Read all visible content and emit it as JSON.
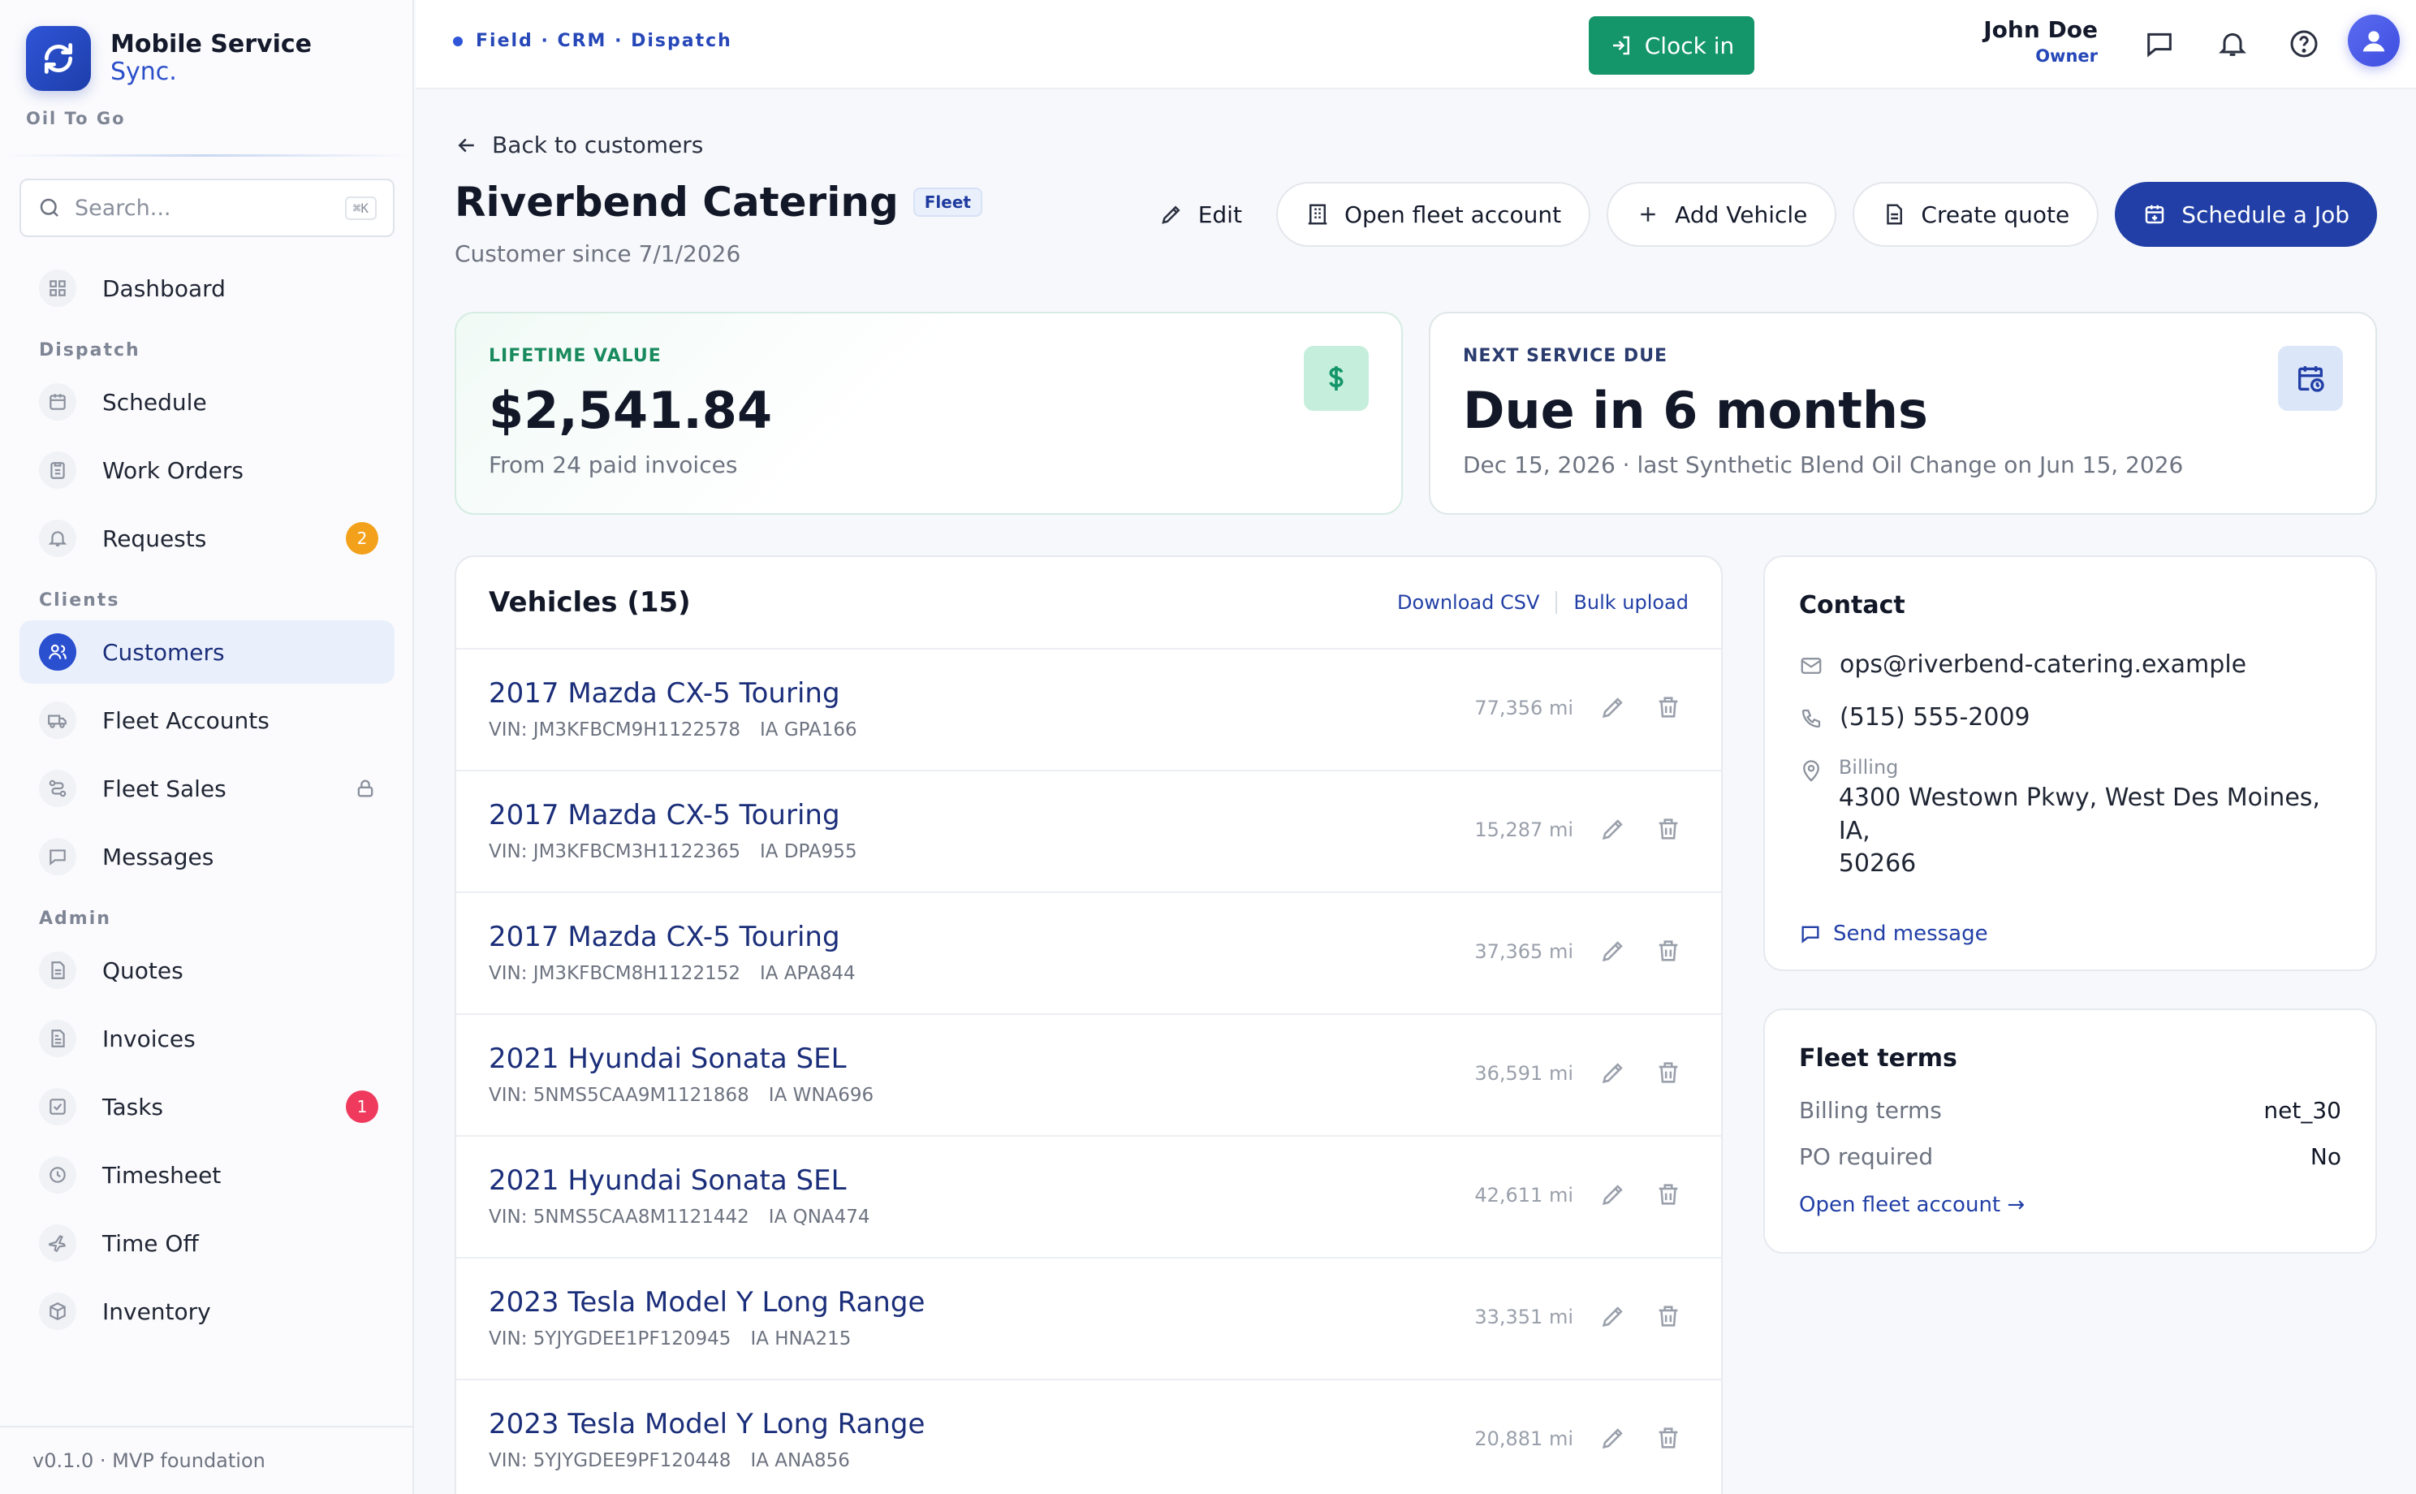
{
  "brand": {
    "name": "Mobile Service",
    "sub": "Sync.",
    "org": "Oil To Go"
  },
  "search": {
    "placeholder": "Search...",
    "shortcut": "⌘K"
  },
  "nav": {
    "dashboard": "Dashboard",
    "dispatch_section": "Dispatch",
    "schedule": "Schedule",
    "work_orders": "Work Orders",
    "requests": "Requests",
    "requests_badge": "2",
    "clients_section": "Clients",
    "customers": "Customers",
    "fleet_accounts": "Fleet Accounts",
    "fleet_sales": "Fleet Sales",
    "messages": "Messages",
    "admin_section": "Admin",
    "quotes": "Quotes",
    "invoices": "Invoices",
    "tasks": "Tasks",
    "tasks_badge": "1",
    "timesheet": "Timesheet",
    "time_off": "Time Off",
    "inventory": "Inventory"
  },
  "footer": {
    "version": "v0.1.0 · MVP foundation"
  },
  "topbar": {
    "crumbs": "Field · CRM · Dispatch",
    "clock_in": "Clock in",
    "user_name": "John Doe",
    "user_role": "Owner"
  },
  "page": {
    "back": "Back to customers",
    "title": "Riverbend Catering",
    "badge": "Fleet",
    "since": "Customer since 7/1/2026",
    "actions": {
      "edit": "Edit",
      "open_fleet": "Open fleet account",
      "add_vehicle": "Add Vehicle",
      "create_quote": "Create quote",
      "schedule_job": "Schedule a Job"
    }
  },
  "stats": {
    "lifetime_label": "LIFETIME VALUE",
    "lifetime_value": "$2,541.84",
    "lifetime_sub": "From 24 paid invoices",
    "next_label": "NEXT SERVICE DUE",
    "next_value": "Due in 6 months",
    "next_sub": "Dec 15, 2026 · last Synthetic Blend Oil Change on Jun 15, 2026"
  },
  "vehicles": {
    "title": "Vehicles (15)",
    "download": "Download CSV",
    "bulk": "Bulk upload",
    "rows": [
      {
        "name": "2017 Mazda CX-5 Touring",
        "vin": "VIN: JM3KFBCM9H1122578",
        "plate": "IA GPA166",
        "miles": "77,356 mi"
      },
      {
        "name": "2017 Mazda CX-5 Touring",
        "vin": "VIN: JM3KFBCM3H1122365",
        "plate": "IA DPA955",
        "miles": "15,287 mi"
      },
      {
        "name": "2017 Mazda CX-5 Touring",
        "vin": "VIN: JM3KFBCM8H1122152",
        "plate": "IA APA844",
        "miles": "37,365 mi"
      },
      {
        "name": "2021 Hyundai Sonata SEL",
        "vin": "VIN: 5NMS5CAA9M1121868",
        "plate": "IA WNA696",
        "miles": "36,591 mi"
      },
      {
        "name": "2021 Hyundai Sonata SEL",
        "vin": "VIN: 5NMS5CAA8M1121442",
        "plate": "IA QNA474",
        "miles": "42,611 mi"
      },
      {
        "name": "2023 Tesla Model Y Long Range",
        "vin": "VIN: 5YJYGDEE1PF120945",
        "plate": "IA HNA215",
        "miles": "33,351 mi"
      },
      {
        "name": "2023 Tesla Model Y Long Range",
        "vin": "VIN: 5YJYGDEE9PF120448",
        "plate": "IA ANA856",
        "miles": "20,881 mi"
      }
    ]
  },
  "contact": {
    "title": "Contact",
    "email": "ops@riverbend-catering.example",
    "phone": "(515) 555-2009",
    "billing_label": "Billing",
    "billing_line1": "4300 Westown Pkwy, West Des Moines, IA,",
    "billing_line2": "50266",
    "send": "Send message"
  },
  "terms": {
    "title": "Fleet terms",
    "billing_key": "Billing terms",
    "billing_val": "net_30",
    "po_key": "PO required",
    "po_val": "No",
    "link": "Open fleet account →"
  },
  "colors": {
    "primary": "#213fa6",
    "accent": "#2f55d8",
    "success": "#14966a",
    "orange": "#f3a11a",
    "red": "#ef3a5d"
  }
}
